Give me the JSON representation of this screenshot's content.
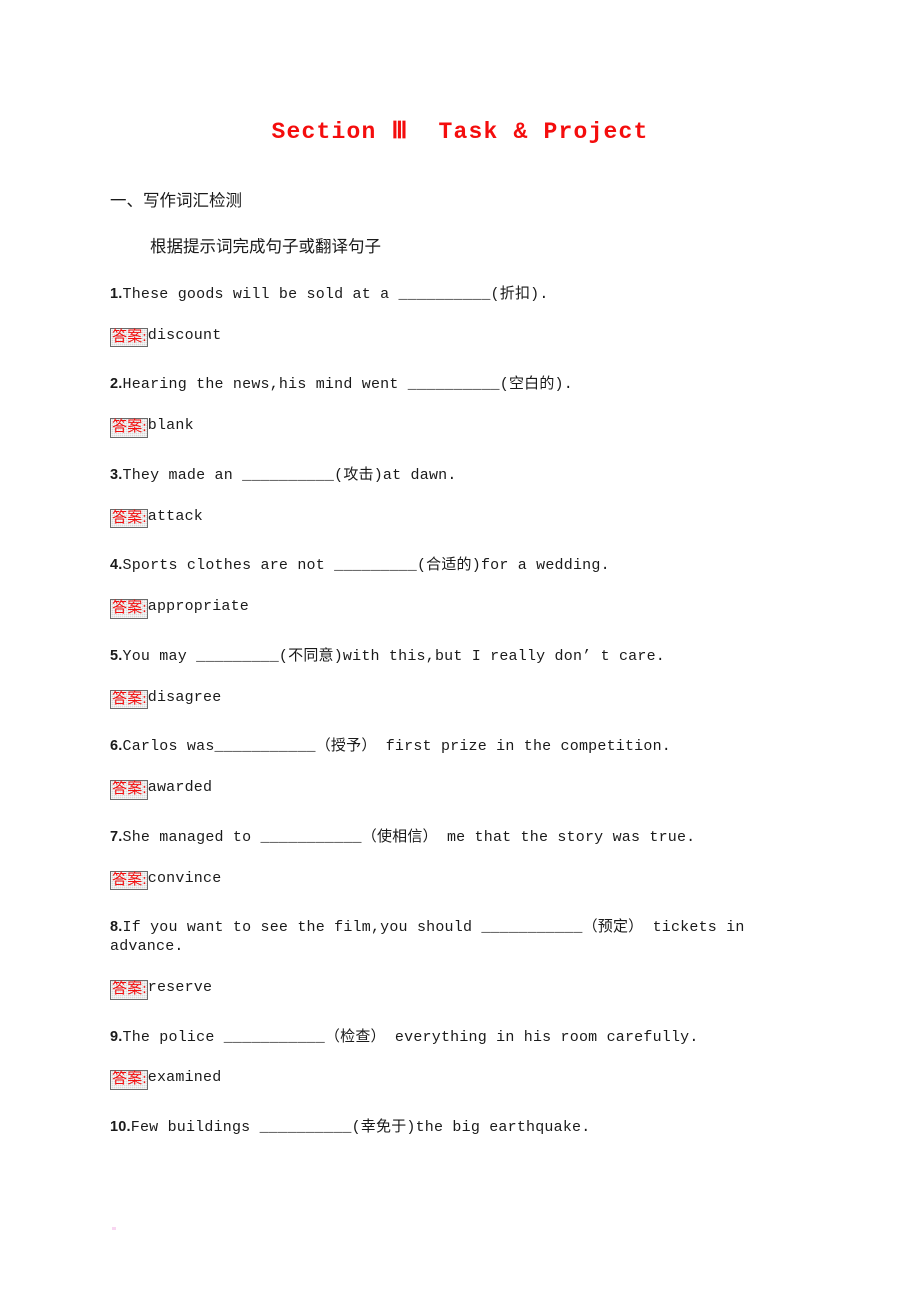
{
  "title": "Section Ⅲ  Task & Project",
  "section_heading": "一、写作词汇检测",
  "instruction": "根据提示词完成句子或翻译句子",
  "answer_label": "答案",
  "answer_separator": ":",
  "colors": {
    "title_red": "#f40d0d",
    "answer_label_red": "#f40d0d",
    "badge_background": "#d9d9d9",
    "badge_border": "#6a6a6a",
    "body_text": "#1a1a1a",
    "page_background": "#ffffff"
  },
  "questions": [
    {
      "number": "1.",
      "text": "These goods will be sold at a __________(折扣).",
      "answer": "discount"
    },
    {
      "number": "2.",
      "text": "Hearing the news,his mind went __________(空白的).",
      "answer": "blank"
    },
    {
      "number": "3.",
      "text": "They made an __________(攻击)at dawn.",
      "answer": "attack"
    },
    {
      "number": "4.",
      "text": "Sports clothes are not _________(合适的)for a wedding.",
      "answer": "appropriate"
    },
    {
      "number": "5.",
      "text": "You may _________(不同意)with this,but I really don’ t care.",
      "answer": "disagree"
    },
    {
      "number": "6.",
      "text": "Carlos was___________（授予） first prize in the competition.",
      "answer": "awarded"
    },
    {
      "number": "7.",
      "text": "She managed to ___________（使相信） me that the story was true.",
      "answer": "convince"
    },
    {
      "number": "8.",
      "text": "If you want to see the film,you should ___________（预定） tickets in advance.",
      "answer": "reserve"
    },
    {
      "number": "9.",
      "text": "The police ___________（检查） everything in his room carefully.",
      "answer": "examined"
    },
    {
      "number": "10.",
      "text": "Few buildings __________(幸免于)the big earthquake.",
      "answer": ""
    }
  ]
}
